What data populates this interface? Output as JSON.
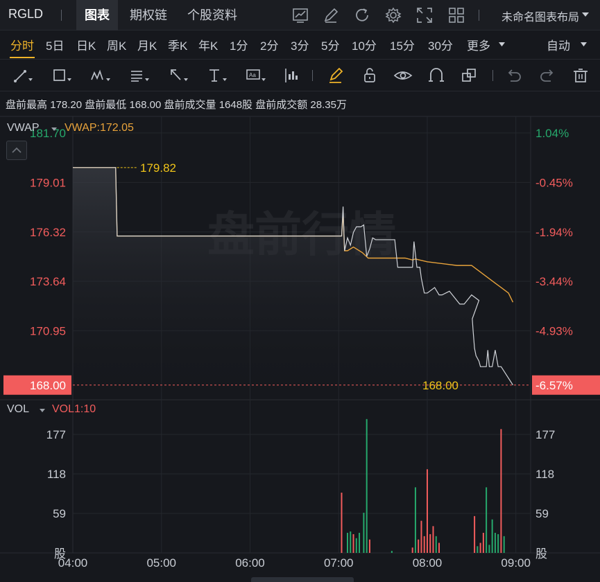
{
  "header": {
    "symbol": "RGLD",
    "tabs": [
      "图表",
      "期权链",
      "个股资料"
    ],
    "layout_name": "未命名图表布局"
  },
  "periods": [
    "分时",
    "5日",
    "日K",
    "周K",
    "月K",
    "季K",
    "年K",
    "1分",
    "2分",
    "3分",
    "5分",
    "10分",
    "15分",
    "30分",
    "更多"
  ],
  "auto_label": "自动",
  "info": {
    "premarket_high_label": "盘前最高",
    "premarket_high": "178.20",
    "premarket_low_label": "盘前最低",
    "premarket_low": "168.00",
    "premarket_volume_label": "盘前成交量",
    "premarket_volume": "1648股",
    "premarket_amount_label": "盘前成交额",
    "premarket_amount": "28.35万"
  },
  "price_panel": {
    "indicator": "VWAP",
    "indicator_value": "VWAP:172.05",
    "watermark": "盘前行情",
    "left_ticks": [
      "181.70",
      "179.01",
      "176.32",
      "173.64",
      "170.95",
      "168.00"
    ],
    "right_ticks": [
      "1.04%",
      "-0.45%",
      "-1.94%",
      "-3.44%",
      "-4.93%",
      "-6.57%"
    ],
    "high_marker": "179.82",
    "last_marker": "168.00",
    "colors": {
      "up": "#26a96c",
      "down": "#f25c5c",
      "vwap": "#e8a33b",
      "price": "#d0d3d8",
      "marker": "#f0c419"
    }
  },
  "volume_panel": {
    "indicator": "VOL",
    "indicator_value": "VOL1:10",
    "left_ticks": [
      "177",
      "118",
      "59",
      "股"
    ],
    "right_ticks": [
      "177",
      "118",
      "59",
      "股"
    ]
  },
  "x_ticks": [
    "04:00",
    "05:00",
    "06:00",
    "07:00",
    "08:00",
    "09:00"
  ],
  "chart_data": {
    "type": "line",
    "x_range": [
      "04:00",
      "09:10"
    ],
    "ylim": [
      167.2,
      182.6
    ],
    "series": [
      {
        "name": "",
        "x_min": [
          0,
          29,
          30,
          182,
          183,
          184,
          186,
          188,
          190,
          192,
          195,
          197,
          199,
          201,
          203,
          205,
          208,
          212,
          215,
          218,
          220,
          225,
          230,
          231,
          233,
          235,
          236,
          238,
          240,
          245,
          248,
          250,
          255,
          262,
          265,
          270,
          275,
          270.5,
          271,
          272,
          273,
          275,
          276,
          278,
          280,
          281,
          282,
          284,
          286,
          288,
          290,
          298
        ],
        "y": [
          179.82,
          179.82,
          176.1,
          176.1,
          177.7,
          175.3,
          176.0,
          175.6,
          176.3,
          176.6,
          176.6,
          176.7,
          175.0,
          175.4,
          176.0,
          175.9,
          175.9,
          175.9,
          175.9,
          175.9,
          174.4,
          174.4,
          174.4,
          175.8,
          174.4,
          174.4,
          173.8,
          173.0,
          173.0,
          173.3,
          172.9,
          172.9,
          173.1,
          172.4,
          172.4,
          172.9,
          172.6,
          171.6,
          171.0,
          170.0,
          169.6,
          169.3,
          169.0,
          169.0,
          169.0,
          169.9,
          169.0,
          169.0,
          169.9,
          169.0,
          169.0,
          168.0
        ]
      },
      {
        "name": "VWAP",
        "x_min": [
          0,
          29,
          30,
          182,
          183,
          184,
          186,
          190,
          196,
          200,
          210,
          220,
          225,
          230,
          232,
          240,
          250,
          260,
          270,
          275,
          280,
          285,
          290,
          295,
          298
        ],
        "y": [
          179.82,
          179.82,
          176.1,
          176.1,
          177.4,
          175.3,
          175.3,
          175.5,
          175.2,
          174.9,
          174.9,
          174.9,
          174.9,
          174.8,
          174.85,
          174.7,
          174.6,
          174.5,
          174.5,
          174.2,
          173.9,
          173.6,
          173.3,
          173.0,
          172.5
        ]
      }
    ],
    "volume": {
      "ylim": [
        0,
        205
      ],
      "bars": [
        {
          "x_min": 182,
          "v": 90,
          "dir": "down"
        },
        {
          "x_min": 186,
          "v": 30,
          "dir": "up"
        },
        {
          "x_min": 188,
          "v": 32,
          "dir": "up"
        },
        {
          "x_min": 190,
          "v": 28,
          "dir": "down"
        },
        {
          "x_min": 192,
          "v": 22,
          "dir": "up"
        },
        {
          "x_min": 194,
          "v": 30,
          "dir": "up"
        },
        {
          "x_min": 197,
          "v": 60,
          "dir": "up"
        },
        {
          "x_min": 199,
          "v": 200,
          "dir": "up"
        },
        {
          "x_min": 201,
          "v": 20,
          "dir": "down"
        },
        {
          "x_min": 216,
          "v": 3,
          "dir": "up"
        },
        {
          "x_min": 230,
          "v": 8,
          "dir": "down"
        },
        {
          "x_min": 232,
          "v": 98,
          "dir": "up"
        },
        {
          "x_min": 234,
          "v": 20,
          "dir": "down"
        },
        {
          "x_min": 236,
          "v": 48,
          "dir": "down"
        },
        {
          "x_min": 238,
          "v": 25,
          "dir": "down"
        },
        {
          "x_min": 240,
          "v": 125,
          "dir": "down"
        },
        {
          "x_min": 242,
          "v": 28,
          "dir": "down"
        },
        {
          "x_min": 244,
          "v": 40,
          "dir": "down"
        },
        {
          "x_min": 246,
          "v": 25,
          "dir": "up"
        },
        {
          "x_min": 248,
          "v": 15,
          "dir": "down"
        },
        {
          "x_min": 272,
          "v": 55,
          "dir": "down"
        },
        {
          "x_min": 274,
          "v": 10,
          "dir": "up"
        },
        {
          "x_min": 276,
          "v": 15,
          "dir": "down"
        },
        {
          "x_min": 278,
          "v": 30,
          "dir": "down"
        },
        {
          "x_min": 280,
          "v": 98,
          "dir": "up"
        },
        {
          "x_min": 282,
          "v": 12,
          "dir": "up"
        },
        {
          "x_min": 284,
          "v": 50,
          "dir": "up"
        },
        {
          "x_min": 286,
          "v": 30,
          "dir": "up"
        },
        {
          "x_min": 288,
          "v": 28,
          "dir": "up"
        },
        {
          "x_min": 290,
          "v": 185,
          "dir": "down"
        },
        {
          "x_min": 292,
          "v": 25,
          "dir": "up"
        }
      ]
    }
  }
}
